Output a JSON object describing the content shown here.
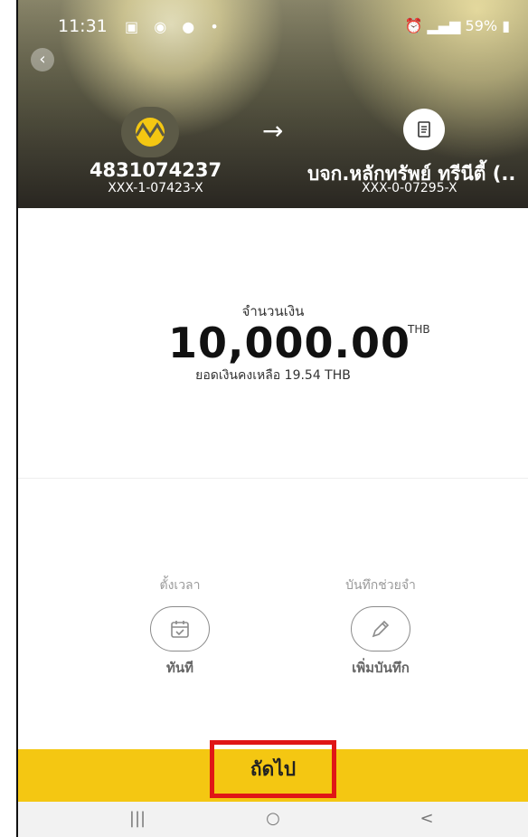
{
  "status_bar": {
    "time": "11:31",
    "left_icons": [
      "gallery-icon",
      "contacts-icon",
      "line-icon",
      "dot-icon"
    ],
    "right_text": "59%"
  },
  "transfer": {
    "from": {
      "account_number": "4831074237",
      "masked": "XXX-1-07423-X"
    },
    "to": {
      "name": "บจก.หลักทรัพย์ ทรีนีตี้ (..",
      "masked": "XXX-0-07295-X"
    }
  },
  "amount": {
    "label": "จำนวนเงิน",
    "value": "10,000.00",
    "currency": "THB",
    "balance_text": "ยอดเงินคงเหลือ 19.54 THB"
  },
  "options": {
    "schedule": {
      "label": "ตั้งเวลา",
      "value": "ทันที",
      "icon": "calendar-icon"
    },
    "memo": {
      "label": "บันทึกช่วยจำ",
      "value": "เพิ่มบันทึก",
      "icon": "pencil-icon"
    }
  },
  "actions": {
    "next_label": "ถัดไป"
  },
  "nav": {
    "recent": "|||",
    "home": "○",
    "back": "<"
  },
  "colors": {
    "accent": "#f4c712",
    "highlight": "#e01616"
  }
}
